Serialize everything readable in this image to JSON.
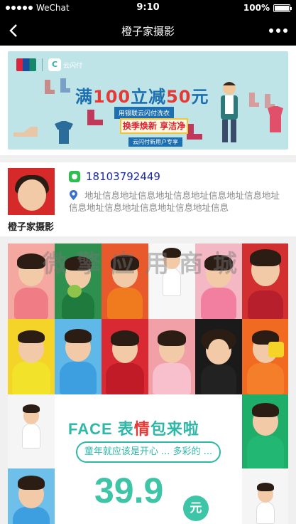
{
  "status_bar": {
    "carrier": "WeChat",
    "time": "9:10",
    "battery": "100%"
  },
  "nav": {
    "title": "橙子家摄影"
  },
  "banner": {
    "cloud_pay": "云闪付",
    "headline_prefix": "满",
    "headline_amount1": "100",
    "headline_mid": "立减",
    "headline_amount2": "50",
    "headline_suffix": "元",
    "tag1": "用银联云闪付洗衣",
    "tag2": "换季焕新 享洁净",
    "tag3": "云闪付新用户专享"
  },
  "shop": {
    "name": "橙子家摄影",
    "phone": "18103792449",
    "address": "地址信息地址信息地址信息地址信息地址信息地址信息地址信息地址信息地址信息地址信息"
  },
  "poster": {
    "watermark": "微擎应用商城",
    "title_part1": "FACE ",
    "title_part2": "表",
    "title_part3": "情",
    "title_part4": "包来啦",
    "subtitle": "童年就应该是开心 ... 多彩的 ...",
    "price": "39.9",
    "currency": "元"
  },
  "colors": {
    "accent": "#2db8a8",
    "phone": "#1a2aa8",
    "nav_bg": "#000000"
  }
}
